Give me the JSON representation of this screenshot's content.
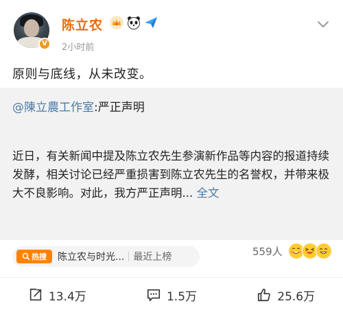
{
  "author": {
    "name": "陈立农",
    "verified_badge": "V",
    "badge_icons": [
      "crown-icon",
      "panda-icon",
      "paper-plane-icon"
    ],
    "time": "2小时前"
  },
  "post": {
    "text": "原则与底线，从未改变。"
  },
  "repost": {
    "mention": "@陳立農工作室",
    "title_suffix": ":严正声明",
    "body": "近日，有关新闻中提及陈立农先生参演新作品等内容的报道持续发酵，相关讨论已经严重损害到陈立农先生的名誉权，并带来极大不良影响。对此，我方严正声明...",
    "full_text_link": "全文"
  },
  "hot_search": {
    "tag": "热搜",
    "topic": "陈立农与时光...",
    "subtitle": "最近上榜"
  },
  "reactions": {
    "count": "559人",
    "emoji_icons": [
      "grin-icon",
      "laugh-icon",
      "smile-icon"
    ]
  },
  "actions": {
    "repost_count": "13.4万",
    "comment_count": "1.5万",
    "like_count": "25.6万"
  },
  "colors": {
    "name_orange": "#e86b0c",
    "link_blue": "#4b7aa8",
    "hot_orange": "#ff8200"
  }
}
